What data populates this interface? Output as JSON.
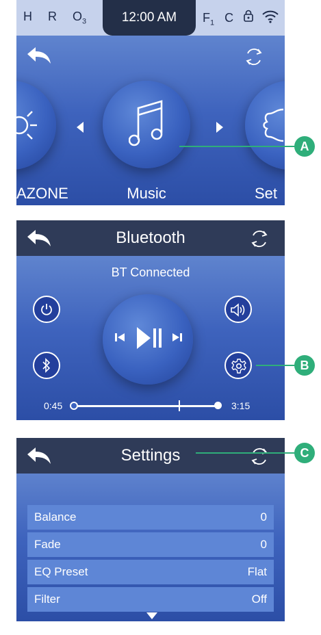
{
  "status_bar": {
    "left_indicators": [
      "H",
      "R",
      "O"
    ],
    "ozone_sub": "3",
    "clock": "12:00 AM",
    "filter": "F",
    "filter_sub": "1",
    "unit": "C"
  },
  "screen_music": {
    "left_label": "AZONE",
    "center_label": "Music",
    "right_label": "Set"
  },
  "screen_bluetooth": {
    "title": "Bluetooth",
    "status": "BT Connected",
    "elapsed": "0:45",
    "total": "3:15",
    "progress": 0.73
  },
  "screen_settings": {
    "title": "Settings",
    "rows": [
      {
        "label": "Balance",
        "value": "0"
      },
      {
        "label": "Fade",
        "value": "0"
      },
      {
        "label": "EQ Preset",
        "value": "Flat"
      },
      {
        "label": "Filter",
        "value": "Off"
      }
    ]
  },
  "callouts": {
    "a": "A",
    "b": "B",
    "c": "C"
  },
  "colors": {
    "accent": "#2fae7a",
    "panel_bg": "#3e63bd",
    "header": "#2f3b58"
  }
}
